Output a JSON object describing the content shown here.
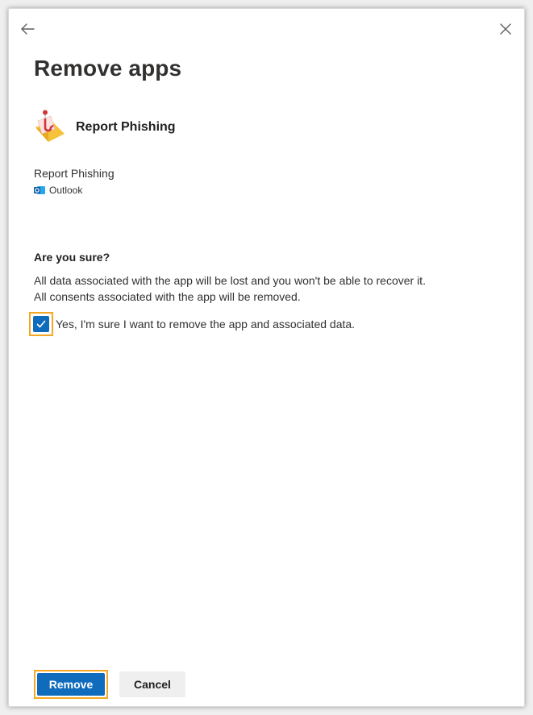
{
  "dialog": {
    "title": "Remove apps",
    "back_icon": "arrow-left-icon",
    "close_icon": "close-icon"
  },
  "app": {
    "name": "Report Phishing",
    "logo_icon": "report-phishing-logo-icon",
    "detail_name": "Report Phishing",
    "host_icon": "outlook-icon",
    "host": "Outlook"
  },
  "confirmation": {
    "heading": "Are you sure?",
    "line1": "All data associated with the app will be lost and you won't be able to recover it.",
    "line2": "All consents associated with the app will be removed.",
    "checkbox_label": "Yes, I'm sure I want to remove the app and associated data.",
    "checkbox_checked": true
  },
  "actions": {
    "remove_label": "Remove",
    "cancel_label": "Cancel"
  },
  "colors": {
    "primary": "#0f6cbd",
    "highlight": "#f5a623",
    "envelope": "#f7c23b",
    "phish_red": "#d13438"
  }
}
